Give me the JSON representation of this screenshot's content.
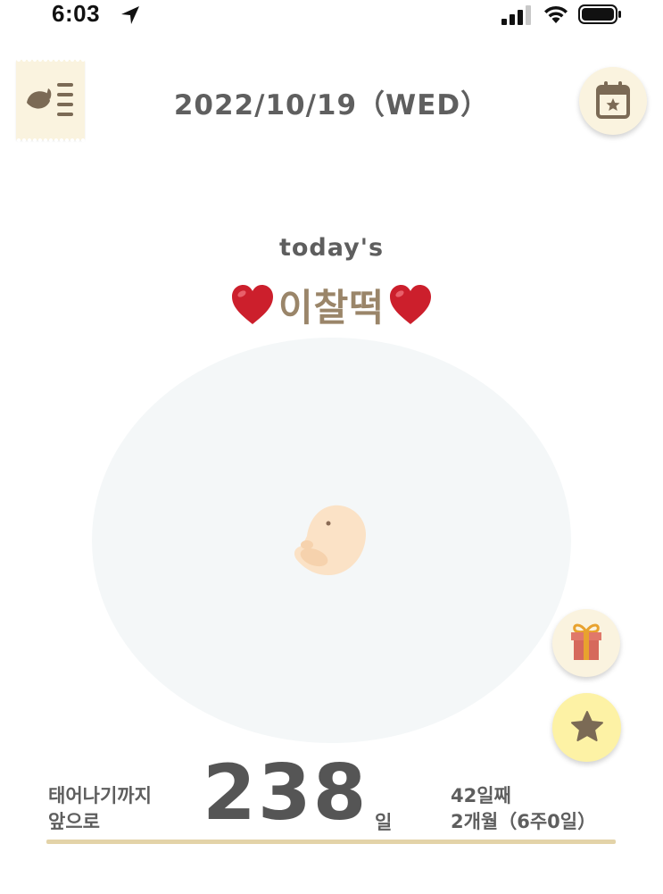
{
  "status_bar": {
    "time": "6:03"
  },
  "header": {
    "date": "2022/10/19（WED）"
  },
  "main": {
    "todays_label": "today's",
    "baby_name": "이찰떡"
  },
  "countdown": {
    "label_line1": "태어나기까지",
    "label_line2": "앞으로",
    "days_remaining": "238",
    "days_unit": "일",
    "day_count": "42일째",
    "age": "2개월（6주0일）"
  },
  "colors": {
    "accent_cream": "#faf3df",
    "star_yellow": "#fdf2a5",
    "name_brown": "#9a8569",
    "progress_gold": "#e3d3a8"
  },
  "icons": [
    "location-arrow-icon",
    "signal-icon",
    "wifi-icon",
    "battery-icon",
    "menu-icon",
    "calendar-star-icon",
    "heart-icon",
    "embryo-illustration",
    "gift-icon",
    "star-icon"
  ]
}
